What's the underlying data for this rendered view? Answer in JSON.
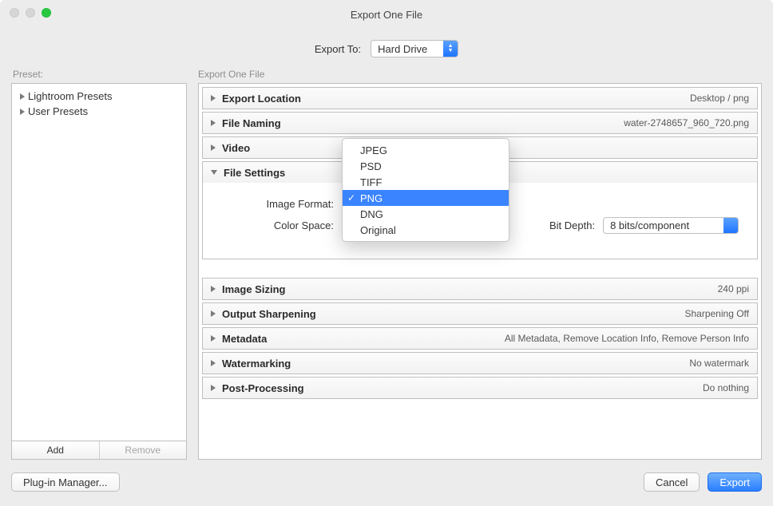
{
  "window": {
    "title": "Export One File"
  },
  "export_to": {
    "label": "Export To:",
    "value": "Hard Drive"
  },
  "preset": {
    "label": "Preset:",
    "items": [
      {
        "label": "Lightroom Presets"
      },
      {
        "label": "User Presets"
      }
    ],
    "add_label": "Add",
    "remove_label": "Remove"
  },
  "main": {
    "label": "Export One File",
    "panels": {
      "export_location": {
        "title": "Export Location",
        "summary": "Desktop / png"
      },
      "file_naming": {
        "title": "File Naming",
        "summary": "water-2748657_960_720.png"
      },
      "video": {
        "title": "Video",
        "summary": ""
      },
      "file_settings": {
        "title": "File Settings",
        "image_format_label": "Image Format:",
        "image_format_value": "PNG",
        "format_options": [
          "JPEG",
          "PSD",
          "TIFF",
          "PNG",
          "DNG",
          "Original"
        ],
        "format_selected": "PNG",
        "color_space_label": "Color Space:",
        "color_space_value": "",
        "bit_depth_label": "Bit Depth:",
        "bit_depth_value": "8 bits/component"
      },
      "image_sizing": {
        "title": "Image Sizing",
        "summary": "240 ppi"
      },
      "output_sharpening": {
        "title": "Output Sharpening",
        "summary": "Sharpening Off"
      },
      "metadata": {
        "title": "Metadata",
        "summary": "All Metadata, Remove Location Info, Remove Person Info"
      },
      "watermarking": {
        "title": "Watermarking",
        "summary": "No watermark"
      },
      "post_processing": {
        "title": "Post-Processing",
        "summary": "Do nothing"
      }
    }
  },
  "footer": {
    "plugin_manager": "Plug-in Manager...",
    "cancel": "Cancel",
    "export": "Export"
  }
}
